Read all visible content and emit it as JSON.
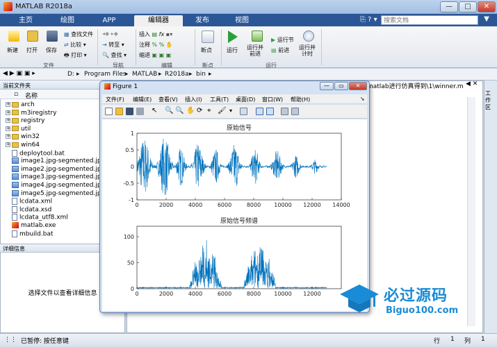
{
  "window": {
    "title": "MATLAB R2018a",
    "min": "—",
    "max": "□",
    "close": "✕"
  },
  "tabs": [
    "主页",
    "绘图",
    "APP",
    "编辑器",
    "发布",
    "视图"
  ],
  "search": {
    "placeholder": "搜索文档"
  },
  "ribbon": {
    "file_group": {
      "label": "文件",
      "new": "新建",
      "open": "打开",
      "save": "保存",
      "find_files": "查找文件",
      "compare": "比较",
      "print": "打印"
    },
    "nav_group": {
      "label": "导航",
      "goto": "转至",
      "find": "查找"
    },
    "edit_group": {
      "label": "编辑",
      "insert": "插入",
      "comment": "注释",
      "indent": "缩进",
      "fx": "fx"
    },
    "breakpoints_group": {
      "label": "断点",
      "breakpoints": "断点"
    },
    "run_group": {
      "label": "运行",
      "run": "运行",
      "run_advance": "运行并\n前进",
      "run_section": "运行节",
      "advance": "前进",
      "run_time": "运行并\n计时"
    }
  },
  "address": [
    "D:",
    "Program Files",
    "MATLAB",
    "R2018a",
    "bin"
  ],
  "folder_panel": {
    "header": "当前文件夹",
    "col_name": "名称",
    "items": [
      {
        "name": "arch",
        "kind": "folder"
      },
      {
        "name": "m3iregistry",
        "kind": "folder"
      },
      {
        "name": "registry",
        "kind": "folder"
      },
      {
        "name": "util",
        "kind": "folder"
      },
      {
        "name": "win32",
        "kind": "folder"
      },
      {
        "name": "win64",
        "kind": "folder"
      },
      {
        "name": "deploytool.bat",
        "kind": "file"
      },
      {
        "name": "image1.jpg-segmented.jpg",
        "kind": "image"
      },
      {
        "name": "image2.jpg-segmented.jpg",
        "kind": "image"
      },
      {
        "name": "image3.jpg-segmented.jpg",
        "kind": "image"
      },
      {
        "name": "image4.jpg-segmented.jpg",
        "kind": "image"
      },
      {
        "name": "image5.jpg-segmented.jpg",
        "kind": "image"
      },
      {
        "name": "lcdata.xml",
        "kind": "file"
      },
      {
        "name": "lcdata.xsd",
        "kind": "file"
      },
      {
        "name": "lcdata_utf8.xml",
        "kind": "file"
      },
      {
        "name": "matlab.exe",
        "kind": "exe"
      },
      {
        "name": "mbuild.bat",
        "kind": "file"
      }
    ]
  },
  "detail_panel": {
    "header": "详细信息",
    "message": "选择文件以查看详细信息"
  },
  "editor": {
    "tab_label": "matlab进行仿真得到\\1\\winner.m",
    "rail_label": "工作区"
  },
  "statusbar": {
    "status": "已暂停: 按任意键",
    "row_label": "行",
    "row_value": "1",
    "col_label": "列",
    "col_value": "1"
  },
  "figure": {
    "title": "Figure 1",
    "menus": [
      "文件(F)",
      "编辑(E)",
      "查看(V)",
      "插入(I)",
      "工具(T)",
      "桌面(D)",
      "窗口(W)",
      "帮助(H)"
    ]
  },
  "chart_data": [
    {
      "type": "line",
      "title": "原始信号",
      "xlabel": "",
      "ylabel": "",
      "xlim": [
        0,
        14000
      ],
      "ylim": [
        -1,
        1
      ],
      "xticks": [
        0,
        2000,
        4000,
        6000,
        8000,
        10000,
        12000,
        14000
      ],
      "yticks": [
        -1,
        -0.5,
        0,
        0.5,
        1
      ],
      "series_color": "#0072bd",
      "bursts": [
        {
          "center": 500,
          "width": 900,
          "amp": 0.9
        },
        {
          "center": 1900,
          "width": 800,
          "amp": 0.95
        },
        {
          "center": 3000,
          "width": 600,
          "amp": 0.6
        },
        {
          "center": 4200,
          "width": 700,
          "amp": 0.75
        },
        {
          "center": 5400,
          "width": 600,
          "amp": 0.55
        },
        {
          "center": 6700,
          "width": 700,
          "amp": 0.72
        },
        {
          "center": 8100,
          "width": 600,
          "amp": 0.55
        },
        {
          "center": 9600,
          "width": 650,
          "amp": 0.5
        },
        {
          "center": 10900,
          "width": 550,
          "amp": 0.35
        },
        {
          "center": 12200,
          "width": 500,
          "amp": 0.22
        }
      ],
      "samples": 13000
    },
    {
      "type": "line",
      "title": "原始信号频谱",
      "xlabel": "",
      "ylabel": "",
      "xlim": [
        0,
        14000
      ],
      "ylim": [
        0,
        120
      ],
      "xticks": [
        0,
        2000,
        4000,
        6000,
        8000,
        10000,
        12000
      ],
      "yticks": [
        0,
        50,
        100
      ],
      "series_color": "#0072bd",
      "peaks": [
        {
          "center": 4700,
          "width": 900,
          "amp": 110
        },
        {
          "center": 8400,
          "width": 900,
          "amp": 110
        }
      ],
      "samples": 13000
    }
  ]
}
